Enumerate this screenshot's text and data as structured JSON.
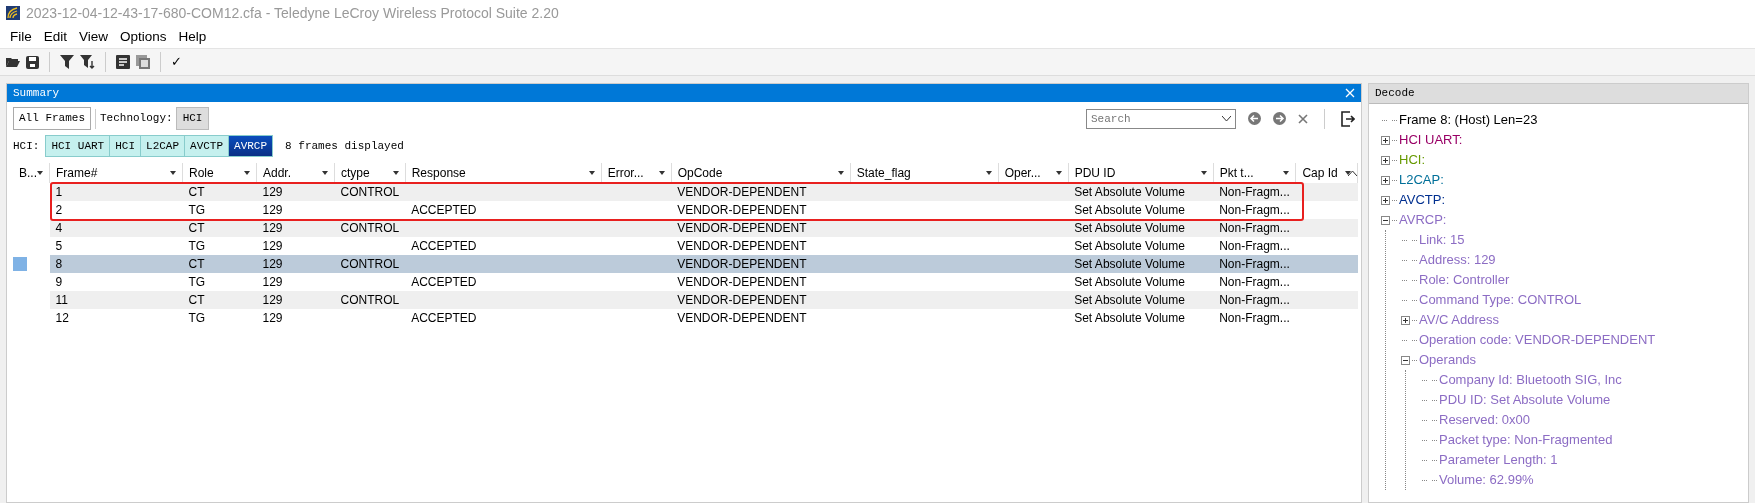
{
  "window": {
    "title": "2023-12-04-12-43-17-680-COM12.cfa - Teledyne LeCroy Wireless Protocol Suite 2.20"
  },
  "menu": [
    "File",
    "Edit",
    "View",
    "Options",
    "Help"
  ],
  "toolbar": {
    "checks": "✓"
  },
  "summary": {
    "title": "Summary",
    "all_frames": "All Frames",
    "technology_label": "Technology:",
    "technology": "HCI",
    "search": {
      "placeholder": "Search"
    },
    "hci_label": "HCI:",
    "layers": [
      {
        "label": "HCI UART",
        "selected": false
      },
      {
        "label": "HCI",
        "selected": false
      },
      {
        "label": "L2CAP",
        "selected": false
      },
      {
        "label": "AVCTP",
        "selected": false
      },
      {
        "label": "AVRCP",
        "selected": true
      }
    ],
    "frames_count": "8 frames displayed",
    "table": {
      "columns": [
        "B...",
        "Frame#",
        "Role",
        "Addr.",
        "ctype",
        "Response",
        "Error...",
        "OpCode",
        "State_flag",
        "Oper...",
        "PDU ID",
        "Pkt t...",
        "Cap Id"
      ],
      "rows": [
        {
          "frame": "1",
          "role": "CT",
          "addr": "129",
          "ctype": "CONTROL",
          "opcode": "VENDOR-DEPENDENT",
          "pdu_id": "Set Absolute Volume",
          "pkt_type": "Non-Fragm...",
          "selected": false,
          "outlined": true
        },
        {
          "frame": "2",
          "role": "TG",
          "addr": "129",
          "response": "ACCEPTED",
          "opcode": "VENDOR-DEPENDENT",
          "pdu_id": "Set Absolute Volume",
          "pkt_type": "Non-Fragm...",
          "selected": false,
          "outlined": true
        },
        {
          "frame": "4",
          "role": "CT",
          "addr": "129",
          "ctype": "CONTROL",
          "opcode": "VENDOR-DEPENDENT",
          "pdu_id": "Set Absolute Volume",
          "pkt_type": "Non-Fragm...",
          "selected": false
        },
        {
          "frame": "5",
          "role": "TG",
          "addr": "129",
          "response": "ACCEPTED",
          "opcode": "VENDOR-DEPENDENT",
          "pdu_id": "Set Absolute Volume",
          "pkt_type": "Non-Fragm...",
          "selected": false
        },
        {
          "frame": "8",
          "role": "CT",
          "addr": "129",
          "ctype": "CONTROL",
          "opcode": "VENDOR-DEPENDENT",
          "pdu_id": "Set Absolute Volume",
          "pkt_type": "Non-Fragm...",
          "selected": true
        },
        {
          "frame": "9",
          "role": "TG",
          "addr": "129",
          "response": "ACCEPTED",
          "opcode": "VENDOR-DEPENDENT",
          "pdu_id": "Set Absolute Volume",
          "pkt_type": "Non-Fragm...",
          "selected": false
        },
        {
          "frame": "11",
          "role": "CT",
          "addr": "129",
          "ctype": "CONTROL",
          "opcode": "VENDOR-DEPENDENT",
          "pdu_id": "Set Absolute Volume",
          "pkt_type": "Non-Fragm...",
          "selected": false
        },
        {
          "frame": "12",
          "role": "TG",
          "addr": "129",
          "response": "ACCEPTED",
          "opcode": "VENDOR-DEPENDENT",
          "pdu_id": "Set Absolute Volume",
          "pkt_type": "Non-Fragm...",
          "selected": false
        }
      ]
    }
  },
  "decode": {
    "title": "Decode",
    "tree": [
      {
        "label": "Frame 8: (Host) Len=23",
        "kind": "leaf",
        "color": "#000000"
      },
      {
        "label": "HCI UART:",
        "kind": "node",
        "expanded": false,
        "color": "#990066"
      },
      {
        "label": "HCI:",
        "kind": "node",
        "expanded": false,
        "color": "#669900"
      },
      {
        "label": "L2CAP:",
        "kind": "node",
        "expanded": false,
        "color": "#006f99"
      },
      {
        "label": "AVCTP:",
        "kind": "node",
        "expanded": false,
        "color": "#002f8f"
      },
      {
        "label": "AVRCP:",
        "kind": "node",
        "expanded": true,
        "color": "#8c6cc4",
        "children": [
          {
            "label": "Link: 15",
            "kind": "leaf"
          },
          {
            "label": "Address: 129",
            "kind": "leaf"
          },
          {
            "label": "Role: Controller",
            "kind": "leaf"
          },
          {
            "label": "Command Type: CONTROL",
            "kind": "leaf"
          },
          {
            "label": "AV/C Address",
            "kind": "node",
            "expanded": false
          },
          {
            "label": "Operation code: VENDOR-DEPENDENT",
            "kind": "leaf"
          },
          {
            "label": "Operands",
            "kind": "node",
            "expanded": true,
            "children": [
              {
                "label": "Company Id: Bluetooth SIG, Inc",
                "kind": "leaf"
              },
              {
                "label": "PDU ID: Set Absolute Volume",
                "kind": "leaf"
              },
              {
                "label": "Reserved: 0x00",
                "kind": "leaf"
              },
              {
                "label": "Packet type: Non-Fragmented",
                "kind": "leaf"
              },
              {
                "label": "Parameter Length: 1",
                "kind": "leaf"
              },
              {
                "label": "Volume: 62.99%",
                "kind": "leaf"
              }
            ]
          }
        ]
      }
    ]
  }
}
